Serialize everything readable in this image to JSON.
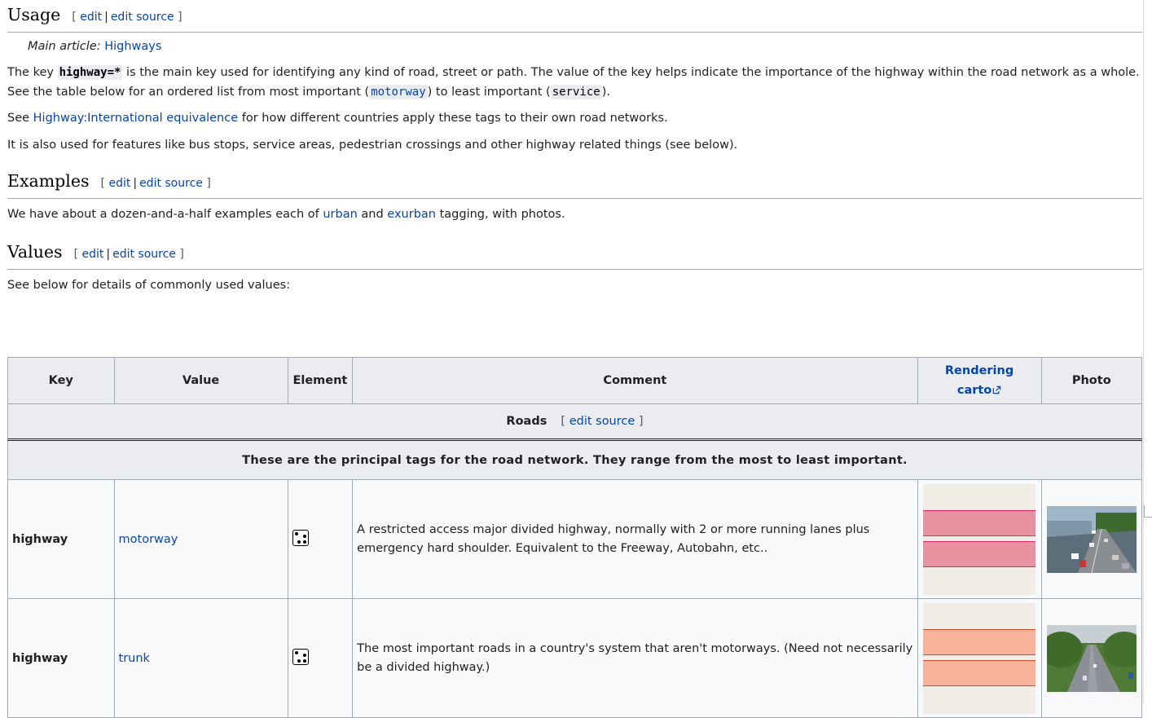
{
  "usage": {
    "heading": "Usage",
    "edit": "edit",
    "edit_source": "edit source",
    "hatnote_prefix": "Main article:",
    "hatnote_link": "Highways",
    "p1_a": "The key ",
    "p1_code": "highway=*",
    "p1_b": " is the main key used for identifying any kind of road, street or path. The value of the key helps indicate the importance of the highway within the road network as a whole. See the table below for an ordered list from most important (",
    "p1_code2": "motorway",
    "p1_c": ") to least important (",
    "p1_code3": "service",
    "p1_d": ").",
    "p2_a": "See ",
    "p2_link": "Highway:International equivalence",
    "p2_b": " for how different countries apply these tags to their own road networks.",
    "p3": "It is also used for features like bus stops, service areas, pedestrian crossings and other highway related things (see below)."
  },
  "examples": {
    "heading": "Examples",
    "edit": "edit",
    "edit_source": "edit source",
    "p_a": "We have about a dozen-and-a-half examples each of ",
    "link1": "urban",
    "p_b": " and ",
    "link2": "exurban",
    "p_c": " tagging, with photos."
  },
  "values": {
    "heading": "Values",
    "edit": "edit",
    "edit_source": "edit source",
    "p": "See below for details of commonly used values:"
  },
  "table": {
    "headers": {
      "key": "Key",
      "value": "Value",
      "element": "Element",
      "comment": "Comment",
      "rendering_line1": "Rendering",
      "rendering_line2": "carto",
      "photo": "Photo"
    },
    "section": {
      "title": "Roads",
      "edit_source": "edit source"
    },
    "note": "These are the principal tags for the road network. They range from the most to least important.",
    "rows": [
      {
        "key": "highway",
        "value": "motorway",
        "comment": "A restricted access major divided highway, normally with 2 or more running lanes plus emergency hard shoulder. Equivalent to the Freeway, Autobahn, etc..",
        "render_color": "#e892a2",
        "render_border": "#dc2a67"
      },
      {
        "key": "highway",
        "value": "trunk",
        "comment": "The most important roads in a country's system that aren't motorways. (Need not necessarily be a divided highway.)",
        "render_color": "#f9b29c",
        "render_border": "#c84e2f"
      }
    ]
  },
  "colors": {
    "link": "#0645ad",
    "border": "#a2a9b1",
    "header_bg": "#eaecf0",
    "row_bg": "#f8f9fa"
  }
}
